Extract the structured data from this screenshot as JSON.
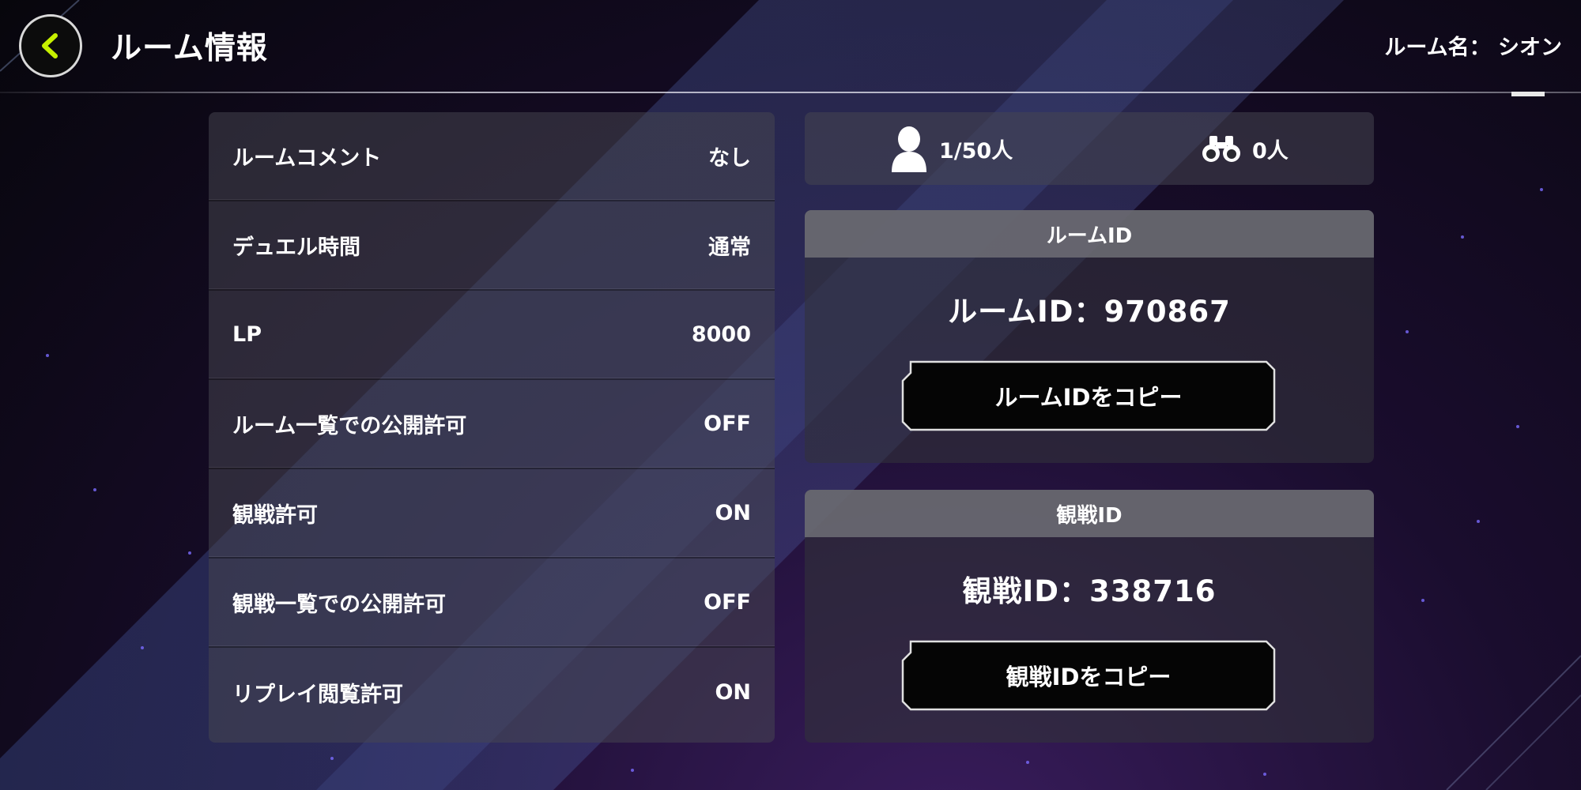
{
  "header": {
    "title": "ルーム情報",
    "room_name": "ルーム名： シオン"
  },
  "settings": [
    {
      "label": "ルームコメント",
      "value": "なし"
    },
    {
      "label": "デュエル時間",
      "value": "通常"
    },
    {
      "label": "LP",
      "value": "8000"
    },
    {
      "label": "ルーム一覧での公開許可",
      "value": "OFF"
    },
    {
      "label": "観戦許可",
      "value": "ON"
    },
    {
      "label": "観戦一覧での公開許可",
      "value": "OFF"
    },
    {
      "label": "リプレイ閲覧許可",
      "value": "ON"
    }
  ],
  "counts": {
    "players": "1/50人",
    "spectators": "0人"
  },
  "room_id_card": {
    "header": "ルームID",
    "value_text": "ルームID：970867",
    "copy_label": "ルームIDをコピー"
  },
  "watch_id_card": {
    "header": "観戦ID",
    "value_text": "観戦ID：338716",
    "copy_label": "観戦IDをコピー"
  },
  "colors": {
    "back_arrow": "#c6f000",
    "background_dark": "#07060c",
    "background_purple": "#3a1d5e"
  },
  "icons": {
    "back": "chevron-left-icon",
    "players": "person-icon",
    "spectators": "binoculars-icon"
  }
}
